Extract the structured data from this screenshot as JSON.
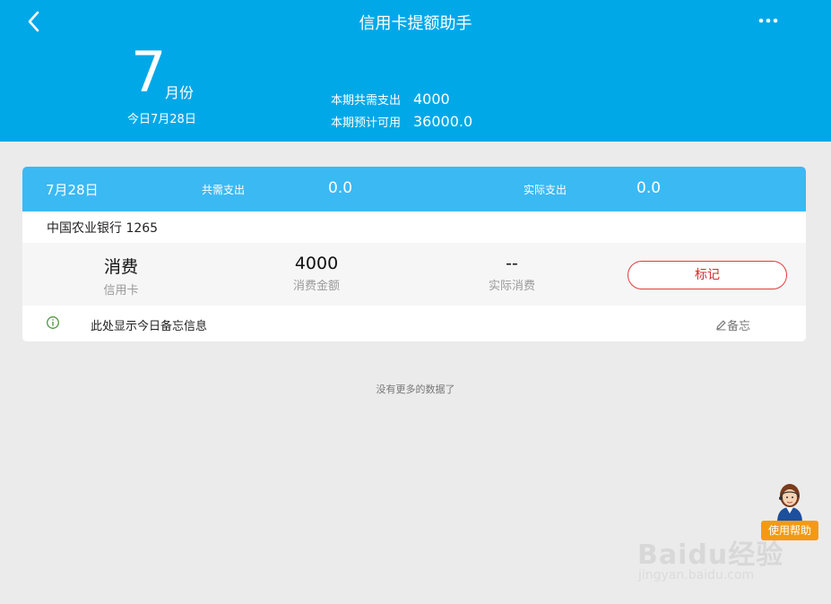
{
  "header": {
    "title": "信用卡提额助手",
    "back_icon": "chevron-left-icon",
    "more_icon": "more-horizontal-icon",
    "background": "#00a8e8"
  },
  "summary": {
    "month_number": "7",
    "month_suffix": "月份",
    "today": "今日7月28日",
    "period_need_label": "本期共需支出",
    "period_need_value": "4000",
    "period_available_label": "本期预计可用",
    "period_available_value": "36000.0"
  },
  "card": {
    "date": "7月28日",
    "need_label": "共需支出",
    "need_value": "0.0",
    "actual_label": "实际支出",
    "actual_value": "0.0",
    "bank": "中国农业银行 1265",
    "type_value": "消费",
    "type_label": "信用卡",
    "amount_value": "4000",
    "amount_label": "消费金额",
    "actual_spend_value": "--",
    "actual_spend_label": "实际消费",
    "mark_button": "标记",
    "memo_text": "此处显示今日备忘信息",
    "memo_button": "备忘",
    "accent": "#e23b3b"
  },
  "footer": {
    "no_more": "没有更多的数据了"
  },
  "help": {
    "label": "使用帮助",
    "color": "#f39a14"
  },
  "watermark": {
    "brand": "Baidu经验",
    "url": "jingyan.baidu.com"
  }
}
